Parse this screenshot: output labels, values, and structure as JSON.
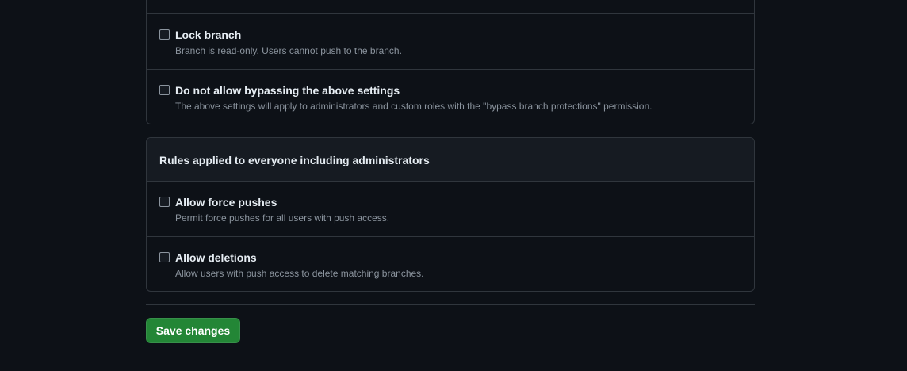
{
  "protection_settings": {
    "items": [
      {
        "title": "Lock branch",
        "description": "Branch is read-only. Users cannot push to the branch.",
        "checked": false
      },
      {
        "title": "Do not allow bypassing the above settings",
        "description": "The above settings will apply to administrators and custom roles with the \"bypass branch protections\" permission.",
        "checked": false
      }
    ]
  },
  "everyone_rules": {
    "header": "Rules applied to everyone including administrators",
    "items": [
      {
        "title": "Allow force pushes",
        "description": "Permit force pushes for all users with push access.",
        "checked": false
      },
      {
        "title": "Allow deletions",
        "description": "Allow users with push access to delete matching branches.",
        "checked": false
      }
    ]
  },
  "actions": {
    "save_label": "Save changes"
  },
  "colors": {
    "background": "#0d1117",
    "border": "#30363d",
    "header_bg": "#161b22",
    "primary_text": "#e6edf3",
    "muted_text": "#8b949e",
    "save_button": "#238636"
  }
}
